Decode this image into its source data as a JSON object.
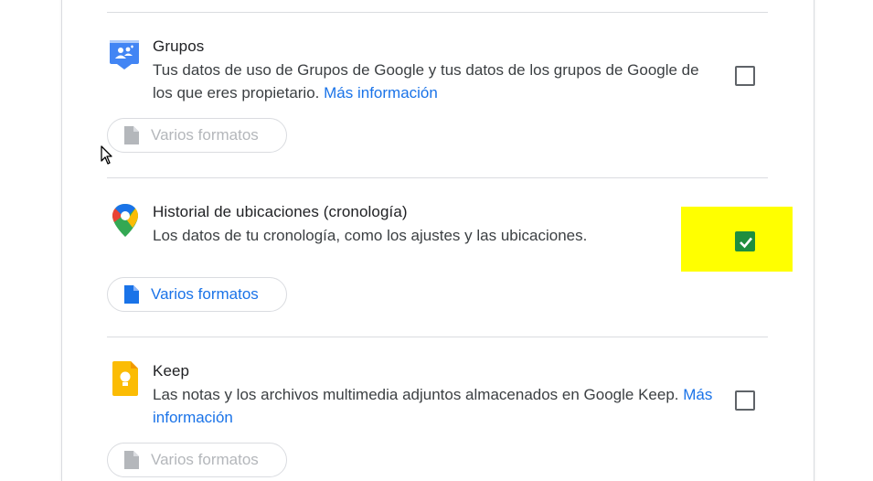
{
  "sections": [
    {
      "title": "Grupos",
      "description": "Tus datos de uso de Grupos de Google y tus datos de los grupos de Google de los que eres propietario.",
      "link": "Más información",
      "format_button": "Varios formatos",
      "checked": false,
      "icon": "groups-icon"
    },
    {
      "title": "Historial de ubicaciones (cronología)",
      "description": "Los datos de tu cronología, como los ajustes y las ubicaciones.",
      "format_button": "Varios formatos",
      "checked": true,
      "icon": "maps-pin-icon"
    },
    {
      "title": "Keep",
      "description": "Las notas y los archivos multimedia adjuntos almacenados en Google Keep.",
      "link": "Más información",
      "format_button": "Varios formatos",
      "checked": false,
      "icon": "keep-icon"
    }
  ],
  "colors": {
    "link": "#1a73e8",
    "checked": "#1e8e3e",
    "highlight": "#ffff00",
    "divider": "#dadce0"
  }
}
